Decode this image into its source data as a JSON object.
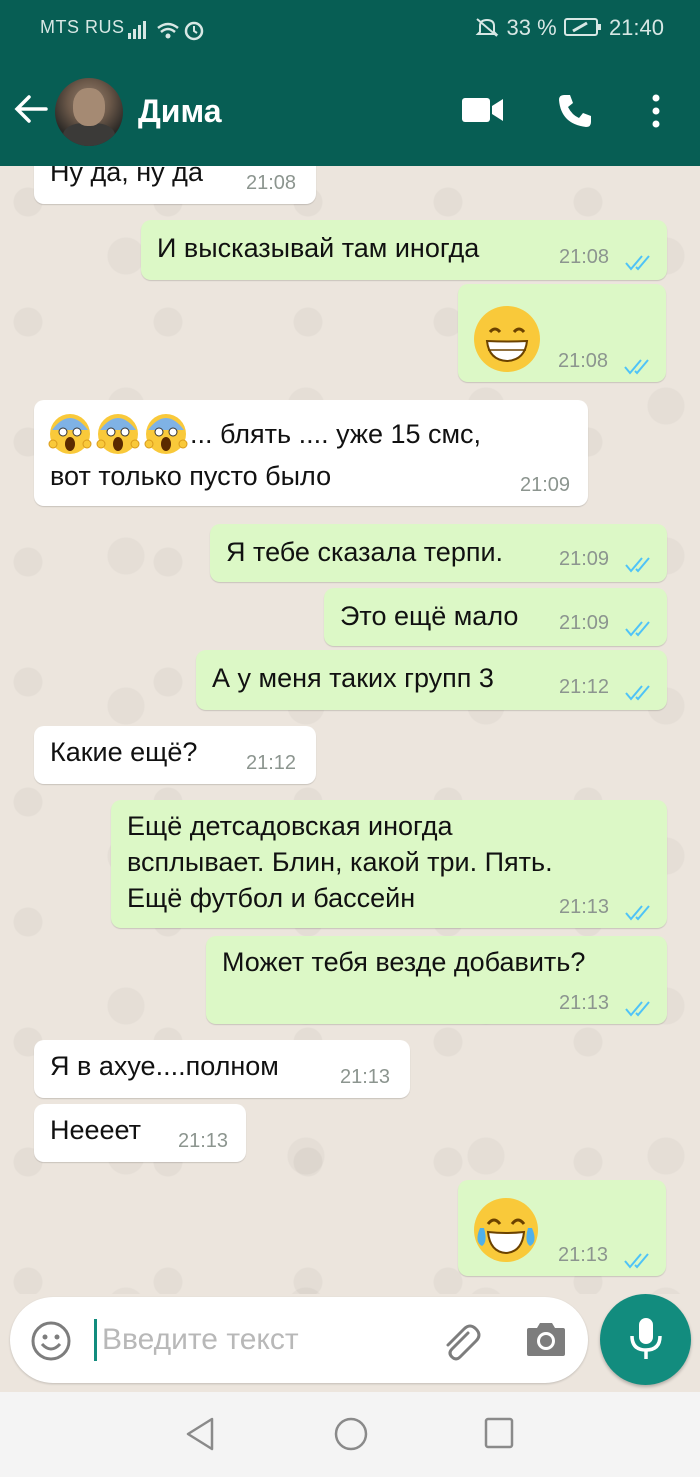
{
  "status_bar": {
    "carrier": "MTS RUS",
    "battery": "33 %",
    "time": "21:40"
  },
  "header": {
    "contact_name": "Дима"
  },
  "messages": [
    {
      "dir": "in",
      "text": "Ну да, ну да",
      "time": "21:08"
    },
    {
      "dir": "out",
      "text": "И высказывай там иногда",
      "time": "21:08"
    },
    {
      "dir": "out",
      "emoji": "grinning",
      "time": "21:08"
    },
    {
      "dir": "in",
      "emoji_prefix": "screaming x3",
      "line1": "... блять .... уже 15 смс,",
      "line2": "вот только пусто было",
      "time": "21:09"
    },
    {
      "dir": "out",
      "text": "Я тебе сказала терпи.",
      "time": "21:09"
    },
    {
      "dir": "out",
      "text": "Это ещё мало",
      "time": "21:09"
    },
    {
      "dir": "out",
      "text": "А у меня таких групп 3",
      "time": "21:12"
    },
    {
      "dir": "in",
      "text": "Какие ещё?",
      "time": "21:12"
    },
    {
      "dir": "out",
      "line1": "Ещё детсадовская иногда",
      "line2": "всплывает. Блин, какой три. Пять.",
      "line3": "Ещё футбол и бассейн",
      "time": "21:13"
    },
    {
      "dir": "out",
      "text": "Может тебя везде добавить?",
      "time": "21:13"
    },
    {
      "dir": "in",
      "text": "Я в ахуе....полном",
      "time": "21:13"
    },
    {
      "dir": "in",
      "text": "Неееет",
      "time": "21:13"
    },
    {
      "dir": "out",
      "emoji": "tears-of-joy",
      "time": "21:13"
    }
  ],
  "input": {
    "placeholder": "Введите текст"
  },
  "colors": {
    "header": "#075e54",
    "outgoing": "#dcf8c6",
    "incoming": "#ffffff",
    "accent": "#128c7e",
    "ticks_read": "#4fc3f7"
  }
}
